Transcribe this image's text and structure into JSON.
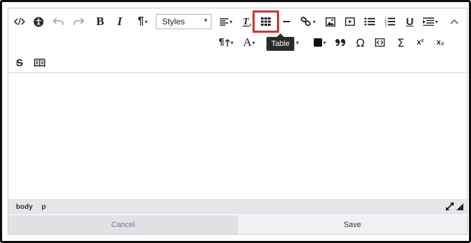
{
  "toolbar": {
    "styles_label": "Styles",
    "table_tooltip": "Table",
    "icons": {
      "source_code": "source-code-icon",
      "accessibility": "accessibility-icon",
      "undo": "undo-icon",
      "redo": "redo-icon",
      "bold": "B",
      "italic": "I",
      "paragraph": "¶",
      "align": "align-left-icon",
      "clear_format": "clear-formatting-icon",
      "table": "table-icon",
      "horizontal_rule": "horizontal-rule-icon",
      "link": "link-icon",
      "image": "image-icon",
      "media": "media-icon",
      "bullet_list": "bullet-list-icon",
      "numbered_list": "numbered-list-icon",
      "underline": "U",
      "indent": "indent-icon",
      "collapse": "chevron-up-icon",
      "text_direction": "text-direction-icon",
      "font_family": "A",
      "background_color": "background-color-icon",
      "blockquote": "blockquote-icon",
      "special_char": "Ω",
      "code_sample": "code-sample-icon",
      "sigma": "Σ",
      "superscript": "x²",
      "subscript": "x₂",
      "strikethrough": "S",
      "book": "book-icon"
    }
  },
  "status": {
    "path": [
      "body",
      "p"
    ]
  },
  "buttons": {
    "cancel_label": "Cancel",
    "save_label": "Save"
  },
  "colors": {
    "highlight": "#d4312e",
    "tooltip_bg": "#2b2b2b",
    "frame": "#0d0d0d"
  }
}
